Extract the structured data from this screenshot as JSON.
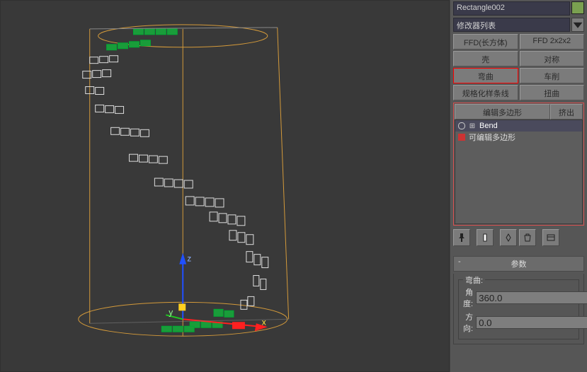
{
  "object_name": "Rectangle002",
  "modifier_dropdown": "修改器列表",
  "buttons": {
    "ffd_box": "FFD(长方体)",
    "ffd_222": "FFD 2x2x2",
    "shell": "壳",
    "symmetry": "对称",
    "bend": "弯曲",
    "lathe": "车削",
    "normalize_spline": "规格化样条线",
    "twist": "扭曲",
    "edit_poly": "编辑多边形",
    "extrude": "挤出"
  },
  "stack": {
    "items": [
      {
        "label": "Bend",
        "selected": true,
        "icon": "eye"
      },
      {
        "label": "可编辑多边形",
        "selected": false,
        "icon": "poly"
      }
    ]
  },
  "params": {
    "rollout_title": "参数",
    "group_title": "弯曲:",
    "angle_label": "角度:",
    "angle_value": "360.0",
    "direction_label": "方向:",
    "direction_value": "0.0"
  },
  "axis_labels": {
    "x": "x",
    "y": "y",
    "z": "z"
  }
}
